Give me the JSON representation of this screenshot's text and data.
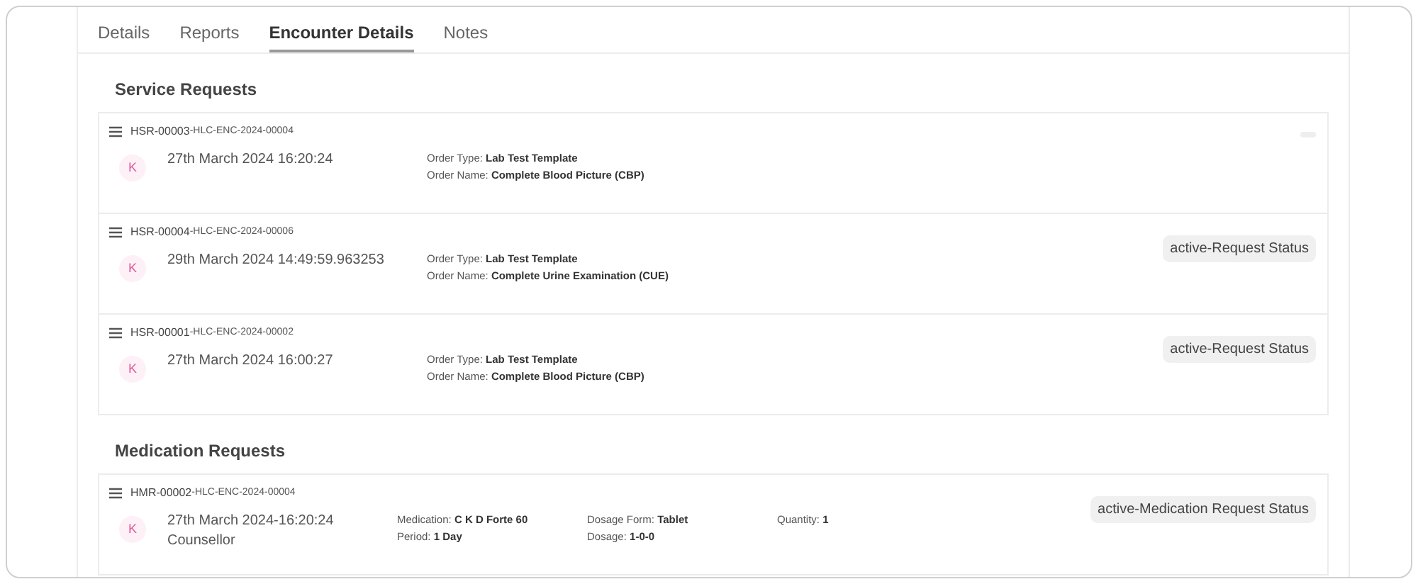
{
  "tabs": [
    {
      "label": "Details",
      "selected": false
    },
    {
      "label": "Reports",
      "selected": false
    },
    {
      "label": "Encounter Details",
      "selected": true
    },
    {
      "label": "Notes",
      "selected": false
    }
  ],
  "sections": [
    {
      "title": "Service Requests",
      "cards": [
        {
          "id": "HSR-00003",
          "encounter": "-HLC-ENC-2024-00004",
          "badge_empty": true,
          "avatar": "K",
          "date": "27th March 2024 16:20:24",
          "columns": [
            [
              {
                "label": "Order Type:",
                "value": "Lab Test Template"
              },
              {
                "label": "Order Name:",
                "value": "Complete Blood Picture (CBP)"
              }
            ]
          ]
        },
        {
          "id": "HSR-00004",
          "encounter": "-HLC-ENC-2024-00006",
          "status": "active-Request Status",
          "avatar": "K",
          "date": "29th March 2024 14:49:59.963253",
          "columns": [
            [
              {
                "label": "Order Type:",
                "value": "Lab Test Template"
              },
              {
                "label": "Order Name:",
                "value": "Complete Urine Examination (CUE)"
              }
            ]
          ]
        },
        {
          "id": "HSR-00001",
          "encounter": "-HLC-ENC-2024-00002",
          "status": "active-Request Status",
          "avatar": "K",
          "date": "27th March 2024 16:00:27",
          "columns": [
            [
              {
                "label": "Order Type:",
                "value": "Lab Test Template"
              },
              {
                "label": "Order Name:",
                "value": "Complete Blood Picture (CBP)"
              }
            ]
          ]
        }
      ]
    },
    {
      "title": "Medication Requests",
      "cards": [
        {
          "id": "HMR-00002",
          "encounter": "-HLC-ENC-2024-00004",
          "status": "active-Medication Request Status",
          "avatar": "K",
          "date": "27th March 2024-16:20:24",
          "subtitle": "Counsellor",
          "columns": [
            [
              {
                "label": "Medication:",
                "value": "C K D Forte 60"
              },
              {
                "label": "Period:",
                "value": "1 Day"
              }
            ],
            [
              {
                "label": "Dosage Form:",
                "value": "Tablet"
              },
              {
                "label": "Dosage:",
                "value": "1-0-0"
              }
            ],
            [
              {
                "label": "Quantity:",
                "value": "1"
              }
            ]
          ]
        }
      ]
    }
  ]
}
